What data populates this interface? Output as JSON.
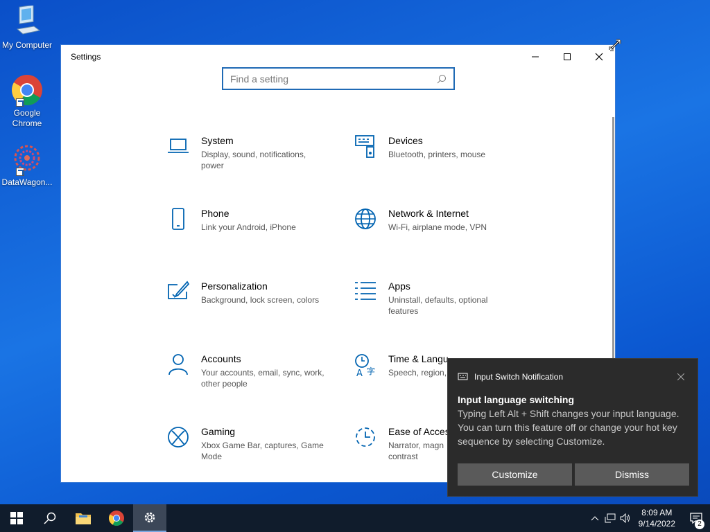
{
  "desktop": {
    "icons": [
      {
        "label": "My Computer",
        "icon": "computer-icon"
      },
      {
        "label": "Google Chrome",
        "icon": "chrome-icon"
      },
      {
        "label": "DataWagon...",
        "icon": "datawagon-icon"
      }
    ]
  },
  "window": {
    "title": "Settings",
    "search_placeholder": "Find a setting",
    "categories": [
      {
        "name": "System",
        "desc": "Display, sound, notifications, power",
        "icon": "laptop-icon"
      },
      {
        "name": "Devices",
        "desc": "Bluetooth, printers, mouse",
        "icon": "keyboard-icon"
      },
      {
        "name": "Phone",
        "desc": "Link your Android, iPhone",
        "icon": "phone-icon"
      },
      {
        "name": "Network & Internet",
        "desc": "Wi-Fi, airplane mode, VPN",
        "icon": "globe-icon"
      },
      {
        "name": "Personalization",
        "desc": "Background, lock screen, colors",
        "icon": "paint-icon"
      },
      {
        "name": "Apps",
        "desc": "Uninstall, defaults, optional features",
        "icon": "apps-list-icon"
      },
      {
        "name": "Accounts",
        "desc": "Your accounts, email, sync, work, other people",
        "icon": "person-icon"
      },
      {
        "name": "Time & Langu",
        "desc": "Speech, region,",
        "icon": "time-language-icon"
      },
      {
        "name": "Gaming",
        "desc": "Xbox Game Bar, captures, Game Mode",
        "icon": "xbox-icon"
      },
      {
        "name": "Ease of Acces",
        "desc": "Narrator, magn contrast",
        "icon": "ease-of-access-icon"
      }
    ]
  },
  "toast": {
    "app": "Input Switch Notification",
    "title": "Input language switching",
    "body": "Typing Left Alt + Shift changes your input language. You can turn this feature off or change your hot key sequence by selecting Customize.",
    "customize": "Customize",
    "dismiss": "Dismiss"
  },
  "taskbar": {
    "time": "8:09 AM",
    "date": "9/14/2022",
    "notification_count": "2"
  },
  "colors": {
    "accent": "#1f6ab5",
    "toast_bg": "#2b2b2b",
    "taskbar_bg": "#101c2c"
  }
}
